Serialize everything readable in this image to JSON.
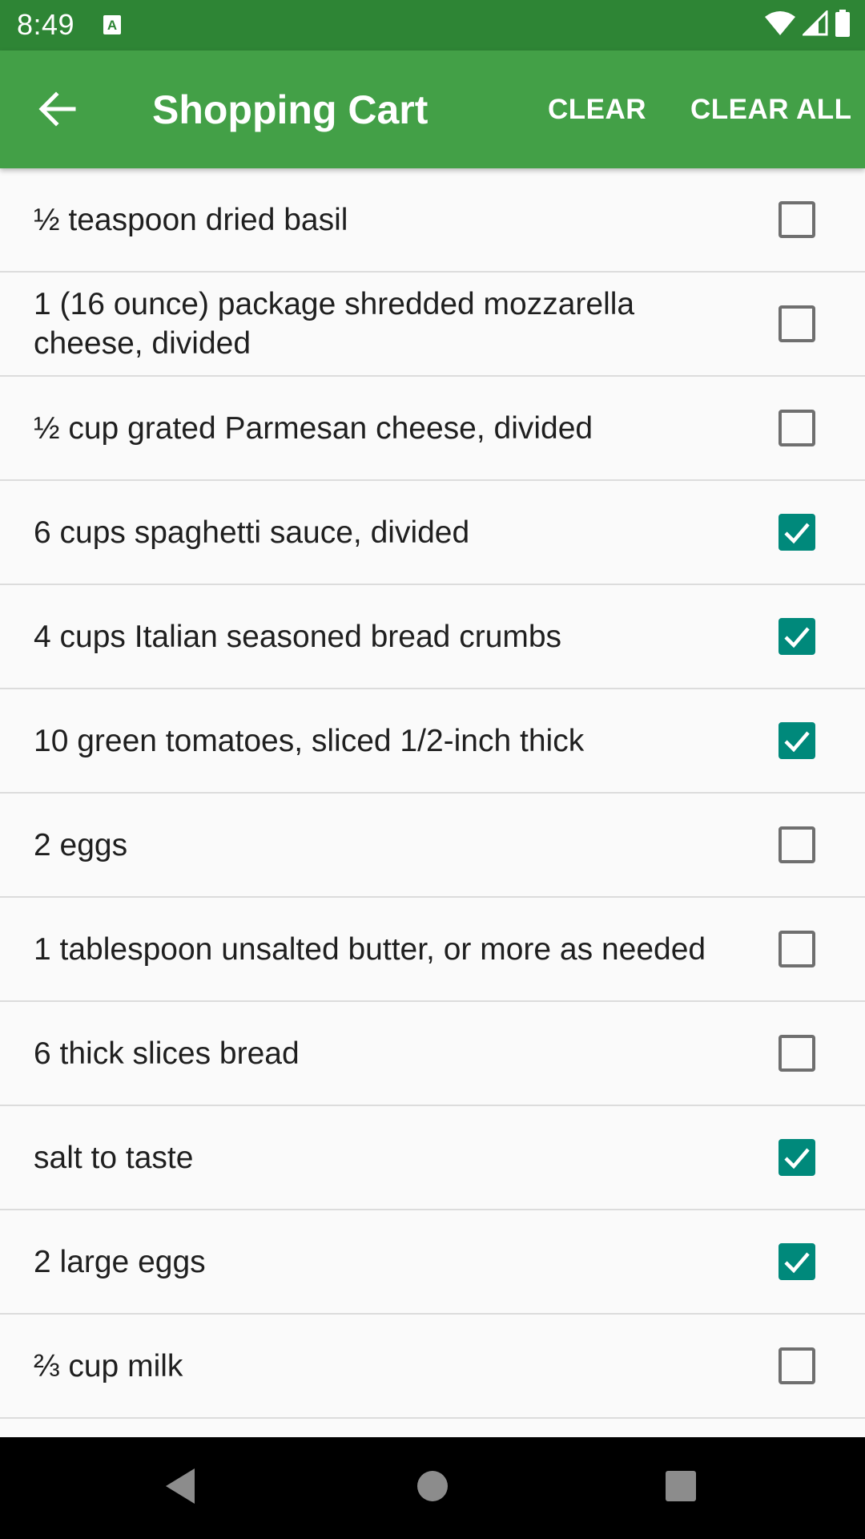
{
  "status_bar": {
    "time": "8:49",
    "notification_icon": "a-badge-icon",
    "icons": [
      "wifi-icon",
      "signal-icon",
      "battery-icon"
    ]
  },
  "app_bar": {
    "title": "Shopping Cart",
    "back_icon": "arrow-back-icon",
    "actions": {
      "clear": "CLEAR",
      "clear_all": "CLEAR ALL"
    }
  },
  "items": [
    {
      "label": "½ teaspoon dried basil",
      "checked": false
    },
    {
      "label": "1 (16 ounce) package shredded mozzarella cheese, divided",
      "checked": false
    },
    {
      "label": "½ cup grated Parmesan cheese, divided",
      "checked": false
    },
    {
      "label": "6 cups spaghetti sauce, divided",
      "checked": true
    },
    {
      "label": "4 cups Italian seasoned bread crumbs",
      "checked": true
    },
    {
      "label": "10 green tomatoes, sliced 1/2-inch thick",
      "checked": true
    },
    {
      "label": "2 eggs",
      "checked": false
    },
    {
      "label": "1 tablespoon unsalted butter, or more as needed",
      "checked": false
    },
    {
      "label": "6 thick slices bread",
      "checked": false
    },
    {
      "label": "salt to taste",
      "checked": true
    },
    {
      "label": "2 large eggs",
      "checked": true
    },
    {
      "label": "⅔ cup milk",
      "checked": false
    }
  ],
  "nav_bar": {
    "icons": [
      "nav-back-icon",
      "nav-home-icon",
      "nav-recents-icon"
    ]
  },
  "colors": {
    "status_bar": "#2e8535",
    "app_bar": "#43a047",
    "checkbox_checked": "#00897b",
    "checkbox_unchecked": "#6f6f6f",
    "nav_bar": "#000000"
  }
}
